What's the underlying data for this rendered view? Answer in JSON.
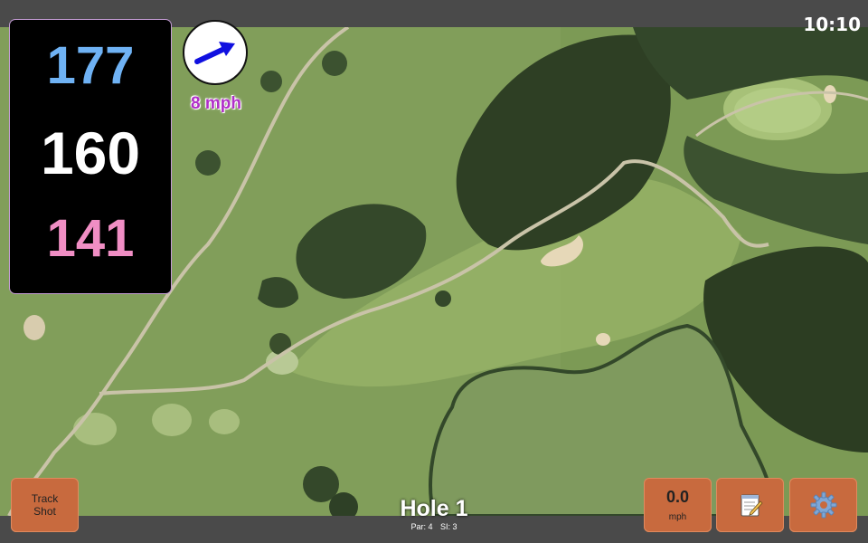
{
  "clock": "10:10",
  "yardages": {
    "back": "177",
    "middle": "160",
    "front": "141",
    "colors": {
      "back": "#6fb2f4",
      "middle": "#ffffff",
      "front": "#f08ec4"
    }
  },
  "wind": {
    "speed_label": "8 mph",
    "icon": "arrow-icon",
    "arrow_color": "#1010e0",
    "label_color": "#b02fc8"
  },
  "buttons": {
    "track_line1": "Track",
    "track_line2": "Shot",
    "speed_value": "0.0",
    "speed_unit": "mph",
    "notes_icon": "notepad-icon",
    "settings_icon": "gear-icon",
    "button_color": "#c86a3e"
  },
  "hole": {
    "title": "Hole 1",
    "par": "Par: 4",
    "si": "SI: 3"
  }
}
